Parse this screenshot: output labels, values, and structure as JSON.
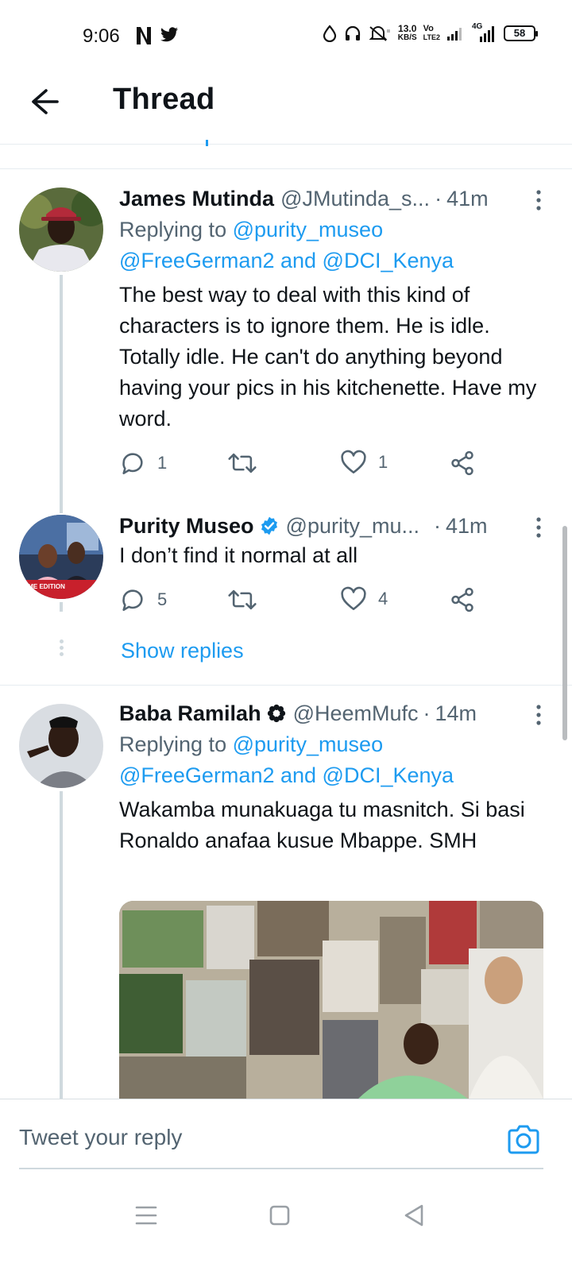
{
  "status_bar": {
    "time": "9:06",
    "net_speed_value": "13.0",
    "net_speed_unit": "KB/S",
    "volte_top": "Vo",
    "volte_bottom": "LTE2",
    "network": "4G",
    "battery": "58"
  },
  "header": {
    "title": "Thread"
  },
  "tweets": [
    {
      "name": "James Mutinda",
      "handle": "@JMutinda_s...",
      "separator": "·",
      "time": "41m",
      "replying_prefix": "Replying to ",
      "reply_mention_1": "@purity_museo",
      "reply_mention_2": "@FreeGerman2",
      "reply_and": " and ",
      "reply_mention_3": "@DCI_Kenya",
      "text": "The best way to deal with this kind of characters is to ignore them. He is idle. Totally idle. He can't do anything beyond having your pics in his kitchenette. Have my word.",
      "replies": "1",
      "retweets": "",
      "likes": "1"
    },
    {
      "name": "Purity Museo",
      "verified": true,
      "handle": "@purity_mu...",
      "separator": "·",
      "time": "41m",
      "text": "I don’t find it normal at all",
      "replies": "5",
      "retweets": "",
      "likes": "4",
      "avatar_badge": "IME EDITION",
      "show_replies": "Show replies"
    },
    {
      "name": "Baba Ramilah",
      "handle": "@HeemMufc",
      "separator": "·",
      "time": "14m",
      "replying_prefix": "Replying to ",
      "reply_mention_1": "@purity_museo",
      "reply_mention_2": "@FreeGerman2",
      "reply_and": " and ",
      "reply_mention_3": "@DCI_Kenya",
      "text": "Wakamba munakuaga tu masnitch. Si basi Ronaldo anafaa kusue Mbappe. SMH"
    }
  ],
  "composer": {
    "placeholder": "Tweet your reply"
  },
  "colors": {
    "accent": "#1d9bf0",
    "secondary_text": "#536471",
    "primary_text": "#0f1419",
    "thread_line": "#cfd9de"
  },
  "icons": [
    "back-arrow-icon",
    "netflix-icon",
    "twitter-icon",
    "reply-icon",
    "retweet-icon",
    "like-icon",
    "share-icon",
    "more-icon",
    "verified-icon",
    "camera-icon",
    "menu-icon",
    "home-icon",
    "back-nav-icon"
  ]
}
